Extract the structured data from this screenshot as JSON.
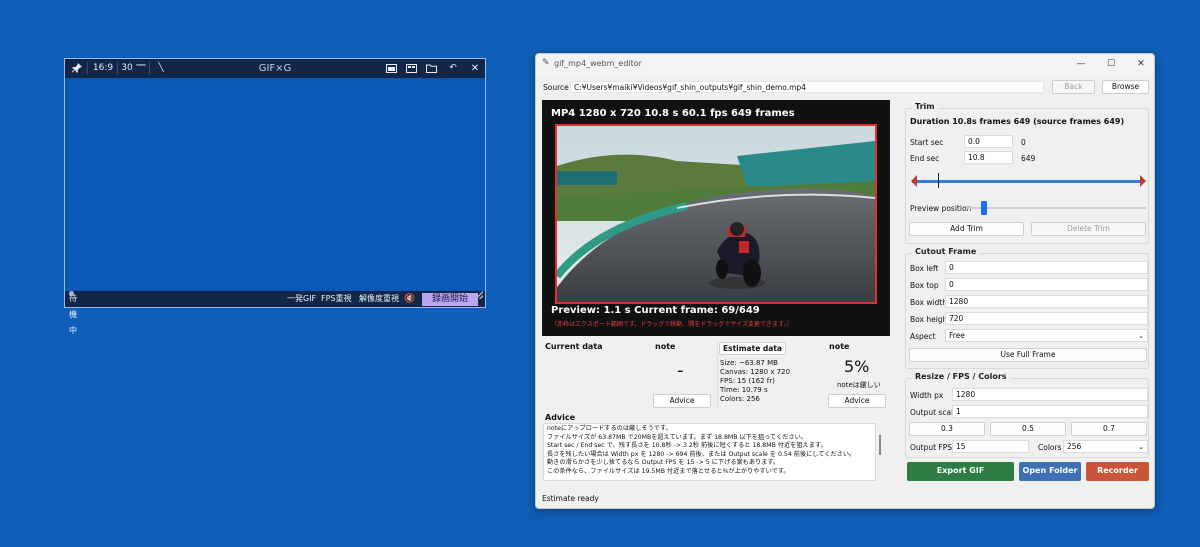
{
  "recorder": {
    "aspect": "16:9",
    "fps": "30",
    "overlay_logo": "GIF×G",
    "status": "待機中",
    "buttons": {
      "one_shot_gif": "一発GIF",
      "fps_priority": "FPS重視",
      "resolution_priority": "解像度重視",
      "start_recording": "録画開始"
    },
    "icons": [
      "pin-icon",
      "line-icon",
      "capture-window-icon",
      "capture-region-icon",
      "folder-icon",
      "undo-icon",
      "close-icon",
      "mute-icon",
      "resize-grip-icon"
    ]
  },
  "editor": {
    "title": "gif_mp4_webm_editor",
    "source_label": "Source",
    "source_path": "C:¥Users¥maiki¥Videos¥gif_shin_outputs¥gif_shin_demo.mp4",
    "back_label": "Back",
    "browse_label": "Browse",
    "preview": {
      "header": "MP4  1280 x 720  10.8 s  60.1 fps  649 frames",
      "status": "Preview: 1.1 s  Current frame: 69/649",
      "hint": "（赤枠はエクスポート範囲です。ドラッグで移動、隅をドラッグでサイズ変更できます。）"
    },
    "current_data_label": "Current data",
    "note1": {
      "title": "note",
      "value": "-",
      "button": "Advice"
    },
    "estimate": {
      "title": "Estimate data",
      "size": "Size: ~63.87 MB",
      "canvas": "Canvas: 1280 x 720",
      "fps": "FPS: 15 (162 fr)",
      "time": "Time: 10.79 s",
      "colors": "Colors: 256"
    },
    "note2": {
      "title": "note",
      "percent": "5%",
      "caption": "noteは厳しい",
      "button": "Advice"
    },
    "advice": {
      "title": "Advice",
      "lines": [
        "noteにアップロードするのは厳しそうです。",
        "ファイルサイズが 63.87MB で20MBを超えています。まず 18.8MB 以下を狙ってください。",
        "Start sec / End sec で、残す長さを 10.8秒 -> 3.2秒 前後に短くすると 18.8MB 付近を狙えます。",
        "長さを残したい場合は Width px を 1280 -> 694 前後、または Output scale を 0.54 前後にしてください。",
        "動きの滑らかさを少し捨てるなら Output FPS を 15 -> 5 に下げる案もあります。",
        "この条件なら、ファイルサイズは 19.5MB 付近まで落とせると%が上がりやすいです。"
      ]
    },
    "status_bar": "Estimate ready",
    "trim": {
      "title": "Trim",
      "summary": "Duration 10.8s  frames 649 (source frames 649)",
      "start_label": "Start sec",
      "start_value": "0.0",
      "start_frame": "0",
      "end_label": "End sec",
      "end_value": "10.8",
      "end_frame": "649",
      "preview_pos_label": "Preview position",
      "preview_position": 0.1,
      "add_trim": "Add Trim",
      "delete_trim": "Delete Trim"
    },
    "cutout": {
      "title": "Cutout Frame",
      "box_left_label": "Box left",
      "box_left": "0",
      "box_top_label": "Box top",
      "box_top": "0",
      "box_width_label": "Box width",
      "box_width": "1280",
      "box_height_label": "Box height",
      "box_height": "720",
      "aspect_label": "Aspect",
      "aspect_value": "Free",
      "use_full_frame": "Use Full Frame"
    },
    "resize": {
      "title": "Resize / FPS / Colors",
      "width_label": "Width px",
      "width_value": "1280",
      "scale_label": "Output scale",
      "scale_value": "1",
      "scale_buttons": [
        "0.3",
        "0.5",
        "0.7"
      ],
      "fps_label": "Output FPS",
      "fps_value": "15",
      "colors_label": "Colors",
      "colors_value": "256"
    },
    "actions": {
      "export_gif": "Export GIF",
      "open_folder": "Open Folder",
      "recorder": "Recorder"
    },
    "colors": {
      "export": "#2e7d44",
      "open_folder": "#3f6fb5",
      "recorder": "#c9553a",
      "timeline": "#3a7bd5",
      "handle": "#c0392b"
    }
  }
}
